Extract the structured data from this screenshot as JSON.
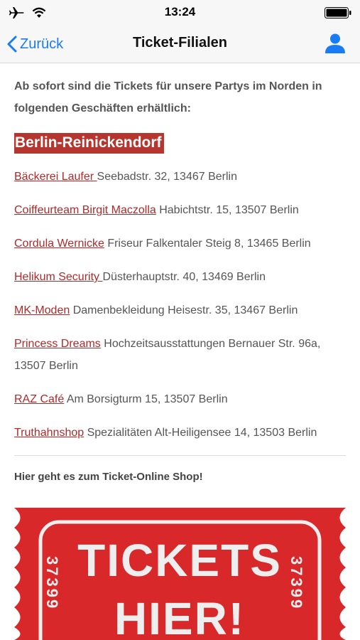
{
  "status": {
    "time": "13:24",
    "icons": [
      "airplane-icon",
      "wifi-icon",
      "battery-icon"
    ]
  },
  "nav": {
    "back_label": "Zurück",
    "title": "Ticket-Filialen",
    "accent": "#1a7cf5"
  },
  "intro": "Ab sofort sind die Tickets für unsere Partys im Norden in folgenden Geschäften erhältlich:",
  "district": "Berlin-Reinickendorf",
  "shops": [
    {
      "name": "Bäckerei Laufer ",
      "detail": " Seebadstr. 32, 13467 Berlin"
    },
    {
      "name": "Coiffeurteam Birgit Maczolla",
      "detail": " Habichtstr. 15, 13507 Berlin"
    },
    {
      "name": "Cordula Wernicke",
      "detail": " Friseur Falkentaler Steig 8, 13465 Berlin"
    },
    {
      "name": "Helikum Security ",
      "detail": "Düsterhauptstr. 40, 13469 Berlin"
    },
    {
      "name": "MK-Moden",
      "detail": " Damenbekleidung Heisestr. 35, 13467 Berlin"
    },
    {
      "name": "Princess Dreams",
      "detail": " Hochzeitsausstattungen Bernauer Str. 96a, 13507 Berlin"
    },
    {
      "name": "RAZ Café",
      "detail": " Am Borsigturm 15, 13507 Berlin"
    },
    {
      "name": "Truthahnshop",
      "detail": " Spezialitäten Alt-Heiligensee 14, 13503 Berlin"
    }
  ],
  "online_label": "Hier geht es zum Ticket-Online Shop!",
  "ticket": {
    "line1": "TICKETS",
    "line2": "HIER!",
    "number": "37399",
    "color": "#d8282a"
  }
}
